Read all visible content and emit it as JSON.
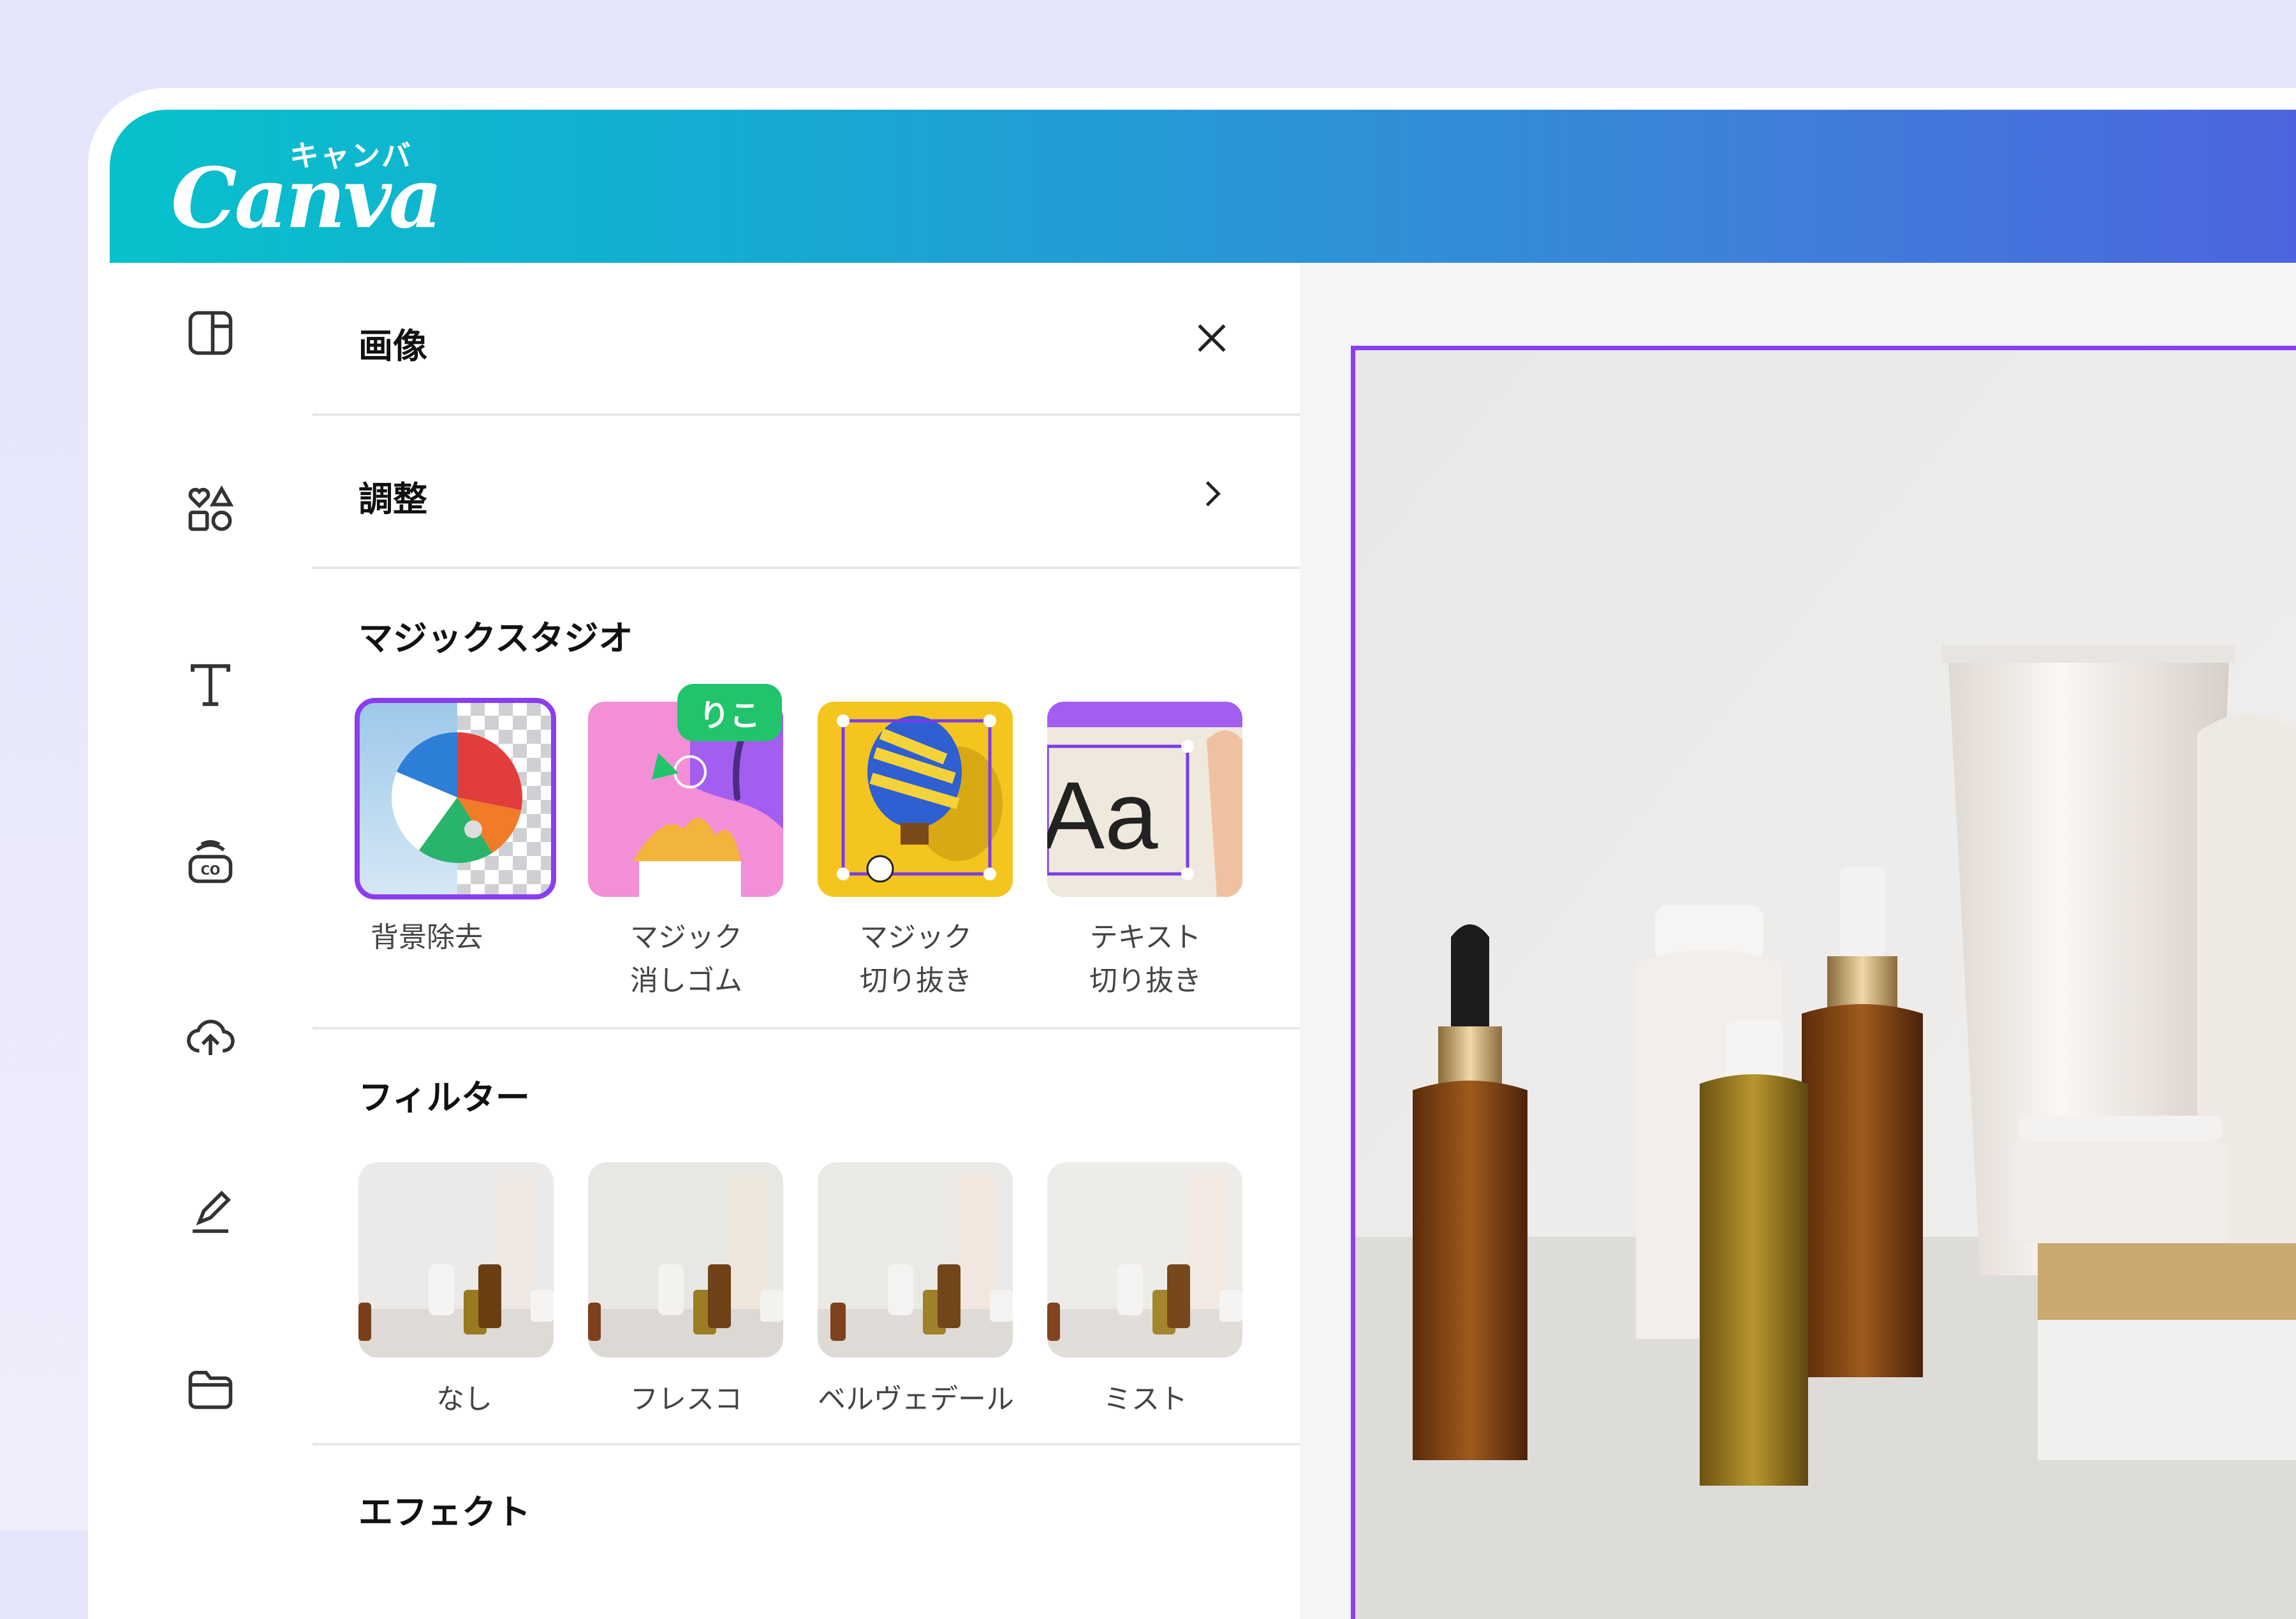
{
  "brand": {
    "wordmark": "Canva",
    "kana": "キャンバ"
  },
  "colors": {
    "accent": "#8b3df2",
    "tag": "#21c46a",
    "header_start": "#07c1cc",
    "header_end": "#4f5fdf"
  },
  "sidebar": {
    "icons": [
      "layout-icon",
      "elements-icon",
      "text-icon",
      "brand-icon",
      "upload-icon",
      "draw-icon",
      "folder-icon"
    ]
  },
  "panel": {
    "title": "画像",
    "adjust_label": "調整",
    "magic_studio": {
      "title": "マジックスタジオ",
      "tag": "りこ",
      "items": [
        {
          "label": "背景除去",
          "selected": true
        },
        {
          "label": "マジック\n消しゴム"
        },
        {
          "label": "マジック\n切り抜き"
        },
        {
          "label": "テキスト\n切り抜き",
          "preview_text": "Aa"
        }
      ]
    },
    "filters": {
      "title": "フィルター",
      "items": [
        {
          "label": "なし"
        },
        {
          "label": "フレスコ"
        },
        {
          "label": "ベルヴェデール"
        },
        {
          "label": "ミスト"
        }
      ]
    },
    "effects": {
      "title": "エフェクト"
    }
  }
}
